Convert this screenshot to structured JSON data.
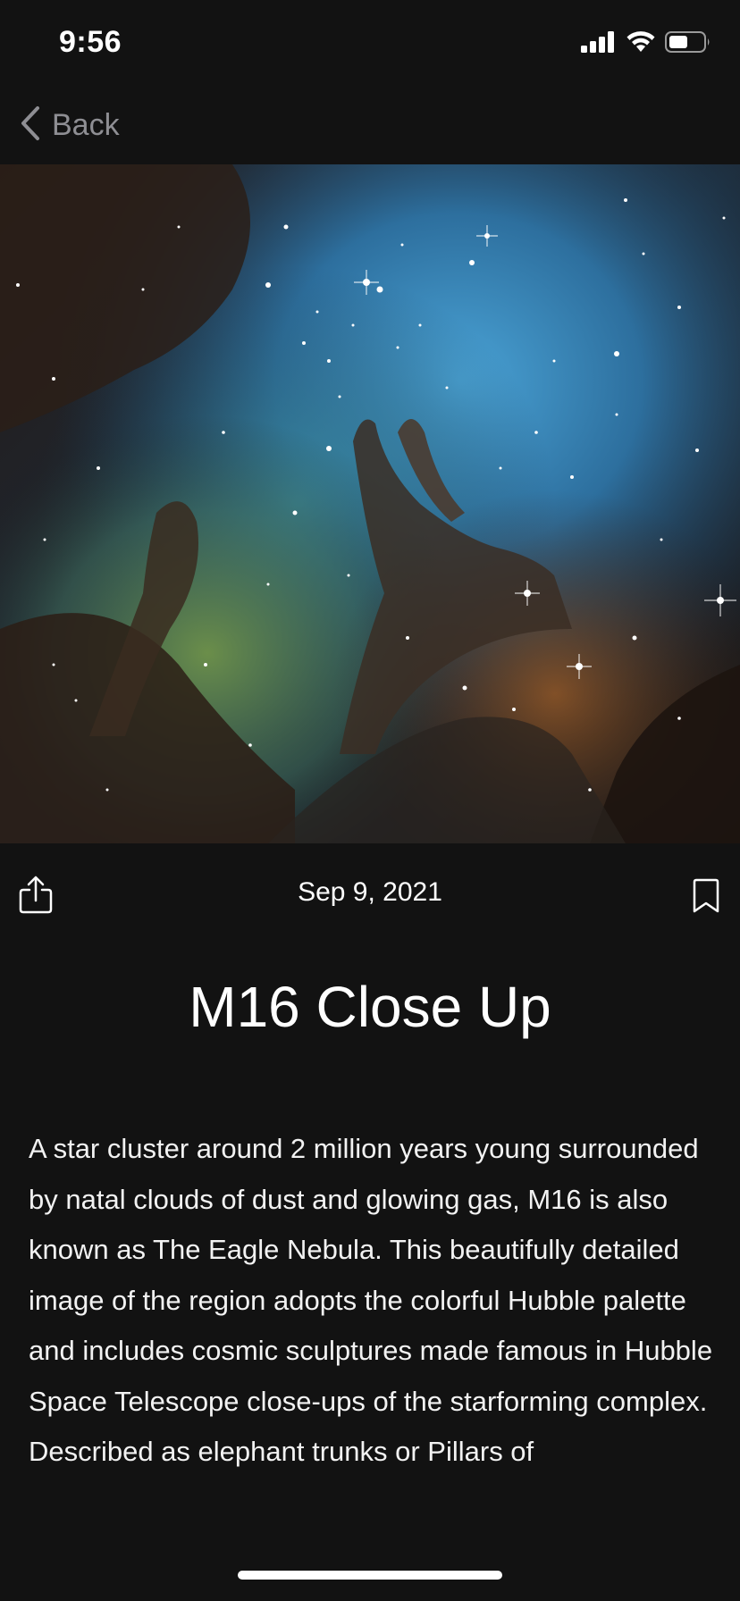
{
  "status_bar": {
    "time": "9:56",
    "icons": [
      "cellular-signal-icon",
      "wifi-icon",
      "battery-icon"
    ]
  },
  "nav": {
    "back_label": "Back",
    "back_icon": "chevron-left-icon"
  },
  "hero": {
    "subject": "nebula-photo"
  },
  "meta": {
    "date": "Sep 9, 2021",
    "share_icon": "share-icon",
    "bookmark_icon": "bookmark-icon"
  },
  "article": {
    "title": "M16 Close Up",
    "description": "A star cluster around 2 million years young surrounded by natal clouds of dust and glowing gas, M16 is also known as The Eagle Nebula. This beautifully detailed image of the region adopts the colorful Hubble palette and includes cosmic sculptures made famous in Hubble Space Telescope close-ups of the starforming complex. Described as elephant trunks or Pillars of"
  },
  "colors": {
    "background": "#121212",
    "text": "#ffffff",
    "secondary_text": "#8e8e93"
  }
}
